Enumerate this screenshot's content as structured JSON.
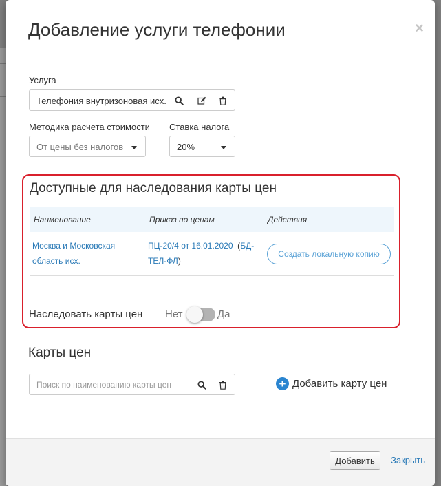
{
  "modal": {
    "title": "Добавление услуги телефонии",
    "close_glyph": "×"
  },
  "service": {
    "label": "Услуга",
    "value": "Телефония внутризоновая исх.",
    "icons": [
      "search-icon",
      "edit-icon",
      "trash-icon"
    ]
  },
  "cost_method": {
    "label": "Методика расчета стоимости",
    "value": "От цены без налогов"
  },
  "tax_rate": {
    "label": "Ставка налога",
    "value": "20%"
  },
  "inherit_section": {
    "title": "Доступные для наследования карты цен",
    "columns": [
      "Наименование",
      "Приказ по ценам",
      "Действия"
    ],
    "rows": [
      {
        "name_line1": "Москва и Московская",
        "name_line2": "область исх.",
        "order_line1": "ПЦ-20/4 от 16.01.2020",
        "order_code_part1": "БД-",
        "order_code_part2": "ТЕЛ-ФЛ",
        "action": "Создать локальную копию"
      }
    ],
    "inherit_label": "Наследовать карты цен",
    "toggle_off": "Нет",
    "toggle_on": "Да",
    "toggle_state": false
  },
  "price_maps": {
    "title": "Карты цен",
    "search_placeholder": "Поиск по наименованию карты цен",
    "add_label": "Добавить карту цен"
  },
  "footer": {
    "add_button": "Добавить",
    "close_link": "Закрыть"
  },
  "colors": {
    "highlight_border": "#d9202c",
    "link": "#2a7ab7",
    "accent_blue": "#2a85d0",
    "table_header_bg": "#eef6fc"
  }
}
